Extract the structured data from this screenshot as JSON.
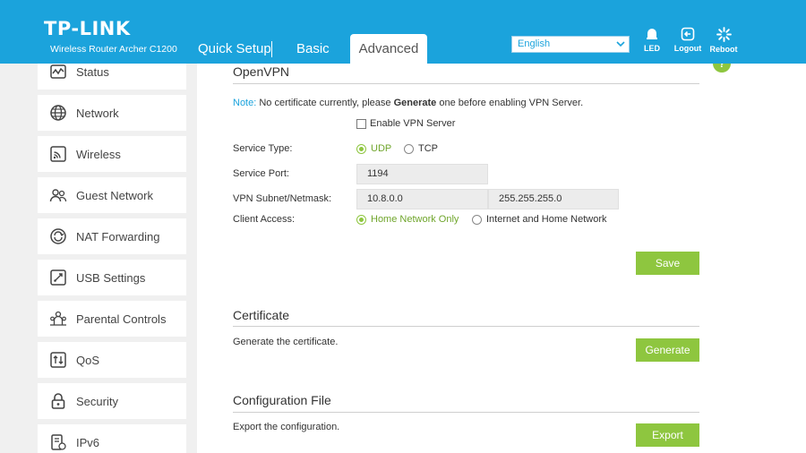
{
  "header": {
    "brand": "TP-LINK",
    "model": "Wireless Router Archer C1200",
    "tabs": [
      {
        "label": "Quick Setup"
      },
      {
        "label": "Basic"
      },
      {
        "label": "Advanced"
      }
    ],
    "language": "English",
    "icons": [
      {
        "label": "LED",
        "icon": "bell-icon"
      },
      {
        "label": "Logout",
        "icon": "logout-icon"
      },
      {
        "label": "Reboot",
        "icon": "reboot-icon"
      }
    ],
    "bg_color": "#1ba3dc"
  },
  "sidebar": {
    "items": [
      {
        "label": "Status",
        "icon": "status-icon"
      },
      {
        "label": "Network",
        "icon": "globe-icon"
      },
      {
        "label": "Wireless",
        "icon": "wireless-icon"
      },
      {
        "label": "Guest Network",
        "icon": "guest-network-icon"
      },
      {
        "label": "NAT Forwarding",
        "icon": "nat-forwarding-icon"
      },
      {
        "label": "USB Settings",
        "icon": "usb-icon"
      },
      {
        "label": "Parental Controls",
        "icon": "parental-controls-icon"
      },
      {
        "label": "QoS",
        "icon": "qos-icon"
      },
      {
        "label": "Security",
        "icon": "lock-icon"
      },
      {
        "label": "IPv6",
        "icon": "ipv6-icon"
      }
    ]
  },
  "openvpn": {
    "title": "OpenVPN",
    "note_label": "Note:",
    "note_pre": "No certificate currently, please",
    "note_bold": "Generate",
    "note_post": "one before enabling VPN Server.",
    "enable_label": "Enable VPN Server",
    "enable_checked": false,
    "service_type_label": "Service Type:",
    "service_type_options": [
      "UDP",
      "TCP"
    ],
    "service_type_selected": "UDP",
    "service_port_label": "Service Port:",
    "service_port_value": "1194",
    "subnet_label": "VPN Subnet/Netmask:",
    "subnet_value": "10.8.0.0",
    "netmask_value": "255.255.255.0",
    "client_access_label": "Client Access:",
    "client_access_options": [
      "Home Network Only",
      "Internet and Home Network"
    ],
    "client_access_selected": "Home Network Only",
    "save_label": "Save"
  },
  "certificate": {
    "title": "Certificate",
    "desc": "Generate the certificate.",
    "button_label": "Generate"
  },
  "config_file": {
    "title": "Configuration File",
    "desc": "Export the configuration.",
    "button_label": "Export"
  },
  "help": {
    "icon": "help-icon",
    "label": "?"
  },
  "colors": {
    "accent_green": "#8ec63f",
    "brand_blue": "#1ba3dc"
  }
}
